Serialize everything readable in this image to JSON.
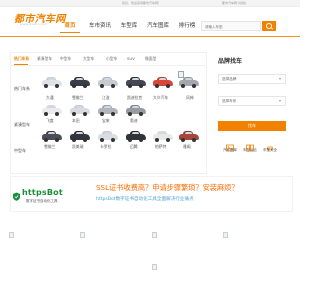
{
  "topbar": {
    "welcome": "您好，欢迎来到都市汽车网！",
    "site_name": "都市汽车网 [切换]",
    "login": "登录"
  },
  "logo": {
    "text": "都市汽车网",
    "url": "www.dushi.com"
  },
  "nav": {
    "items": [
      "首页",
      "车市资讯",
      "车型库",
      "汽车图库",
      "排行榜"
    ],
    "active_index": 0
  },
  "search": {
    "placeholder": "请输入车型"
  },
  "hot_models": {
    "title": "热门车系",
    "tabs": [
      "紧凑型车",
      "中型车",
      "大型车",
      "小型车",
      "SUV",
      "微面型"
    ],
    "rows": [
      {
        "category": "热门车系",
        "cars": [
          "大通",
          "雪佛兰",
          "江淮",
          "凯迪拉克",
          "大众汽车",
          "风神"
        ]
      },
      {
        "category": "紧凑型车",
        "cars": [
          "飞度",
          "本田",
          "宝来",
          "奥迪",
          "",
          ""
        ]
      },
      {
        "category": "中型车",
        "cars": [
          "雪佛兰",
          "凯美瑞",
          "卡罗拉",
          "迈腾",
          "帕萨特",
          "雅阁"
        ]
      }
    ]
  },
  "finder": {
    "title": "品牌找车",
    "select_brand": "选择品牌",
    "select_series": "选择车系",
    "button": "找车",
    "tools": [
      "汽车图库",
      "车型对比",
      "车型大全"
    ]
  },
  "ad": {
    "logo": "httpsBot",
    "sub": "数字证书自动化工具",
    "headline": "SSL证书收费高？申请步骤繁琐？安装麻烦？",
    "line": "httpsBot数字证书自动化工具全面解决行业痛点"
  },
  "colors": {
    "accent": "#f08200",
    "ad_headline": "#ff6a00",
    "ad_line": "#4ea3d9",
    "ad_logo": "#1a8f3a"
  }
}
